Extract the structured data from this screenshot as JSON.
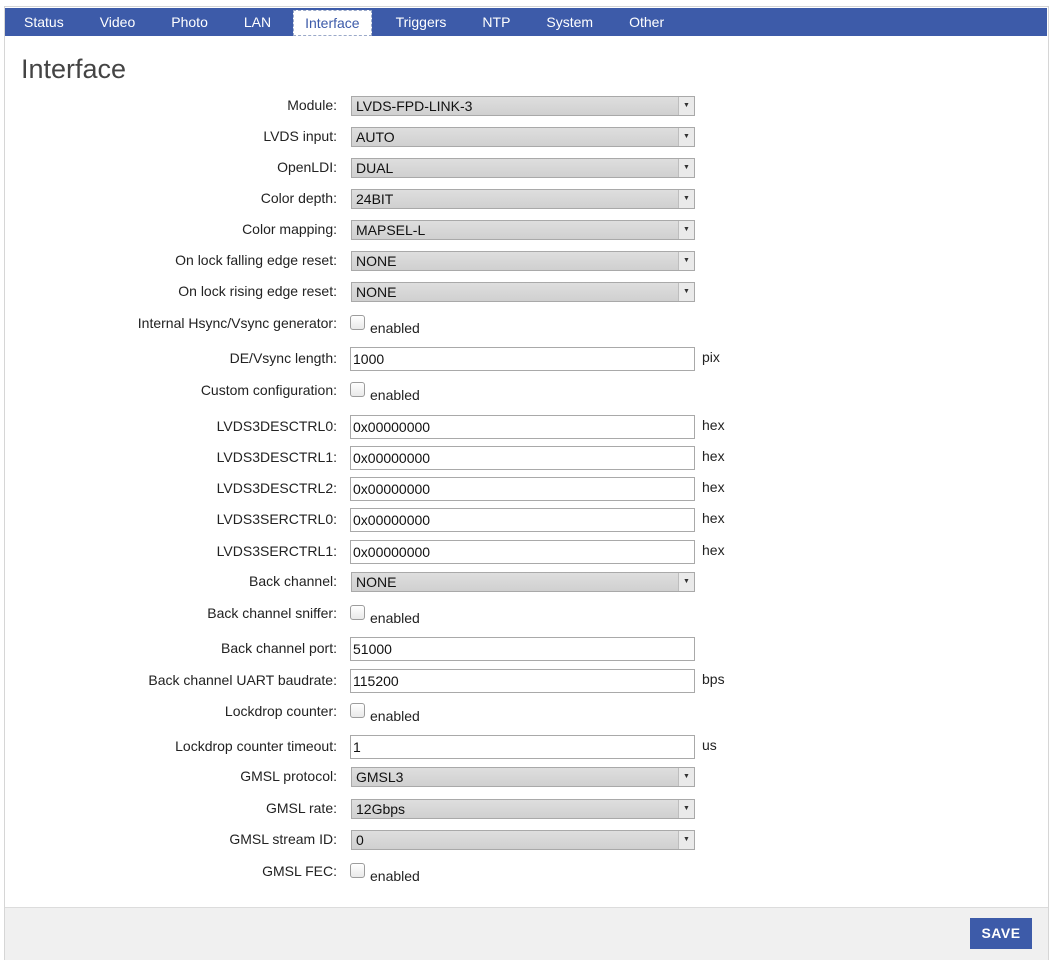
{
  "nav": {
    "tabs": [
      "Status",
      "Video",
      "Photo",
      "LAN",
      "Interface",
      "Triggers",
      "NTP",
      "System",
      "Other"
    ],
    "active": "Interface"
  },
  "page": {
    "title": "Interface"
  },
  "form": {
    "module": {
      "label": "Module:",
      "value": "LVDS-FPD-LINK-3"
    },
    "lvds_input": {
      "label": "LVDS input:",
      "value": "AUTO"
    },
    "openldi": {
      "label": "OpenLDI:",
      "value": "DUAL"
    },
    "color_depth": {
      "label": "Color depth:",
      "value": "24BIT"
    },
    "color_mapping": {
      "label": "Color mapping:",
      "value": "MAPSEL-L"
    },
    "on_lock_falling": {
      "label": "On lock falling edge reset:",
      "value": "NONE"
    },
    "on_lock_rising": {
      "label": "On lock rising edge reset:",
      "value": "NONE"
    },
    "internal_gen": {
      "label": "Internal Hsync/Vsync generator:",
      "check_label": "enabled",
      "checked": false
    },
    "de_vsync_length": {
      "label": "DE/Vsync length:",
      "value": "1000",
      "unit": "pix"
    },
    "custom_config": {
      "label": "Custom configuration:",
      "check_label": "enabled",
      "checked": false
    },
    "lvds3desctrl0": {
      "label": "LVDS3DESCTRL0:",
      "value": "0x00000000",
      "unit": "hex"
    },
    "lvds3desctrl1": {
      "label": "LVDS3DESCTRL1:",
      "value": "0x00000000",
      "unit": "hex"
    },
    "lvds3desctrl2": {
      "label": "LVDS3DESCTRL2:",
      "value": "0x00000000",
      "unit": "hex"
    },
    "lvds3serctrl0": {
      "label": "LVDS3SERCTRL0:",
      "value": "0x00000000",
      "unit": "hex"
    },
    "lvds3serctrl1": {
      "label": "LVDS3SERCTRL1:",
      "value": "0x00000000",
      "unit": "hex"
    },
    "back_channel": {
      "label": "Back channel:",
      "value": "NONE"
    },
    "back_channel_sniffer": {
      "label": "Back channel sniffer:",
      "check_label": "enabled",
      "checked": false
    },
    "back_channel_port": {
      "label": "Back channel port:",
      "value": "51000"
    },
    "back_channel_baud": {
      "label": "Back channel UART baudrate:",
      "value": "115200",
      "unit": "bps"
    },
    "lockdrop_counter": {
      "label": "Lockdrop counter:",
      "check_label": "enabled",
      "checked": false
    },
    "lockdrop_timeout": {
      "label": "Lockdrop counter timeout:",
      "value": "1",
      "unit": "us"
    },
    "gmsl_protocol": {
      "label": "GMSL protocol:",
      "value": "GMSL3"
    },
    "gmsl_rate": {
      "label": "GMSL rate:",
      "value": "12Gbps"
    },
    "gmsl_stream_id": {
      "label": "GMSL stream ID:",
      "value": "0"
    },
    "gmsl_fec": {
      "label": "GMSL FEC:",
      "check_label": "enabled",
      "checked": false
    }
  },
  "footer": {
    "save_label": "SAVE"
  },
  "colors": {
    "accent": "#3d5ba9",
    "footer_bg": "#f0f0f0"
  },
  "icons": {
    "select_arrow": "chevron-down-icon"
  }
}
